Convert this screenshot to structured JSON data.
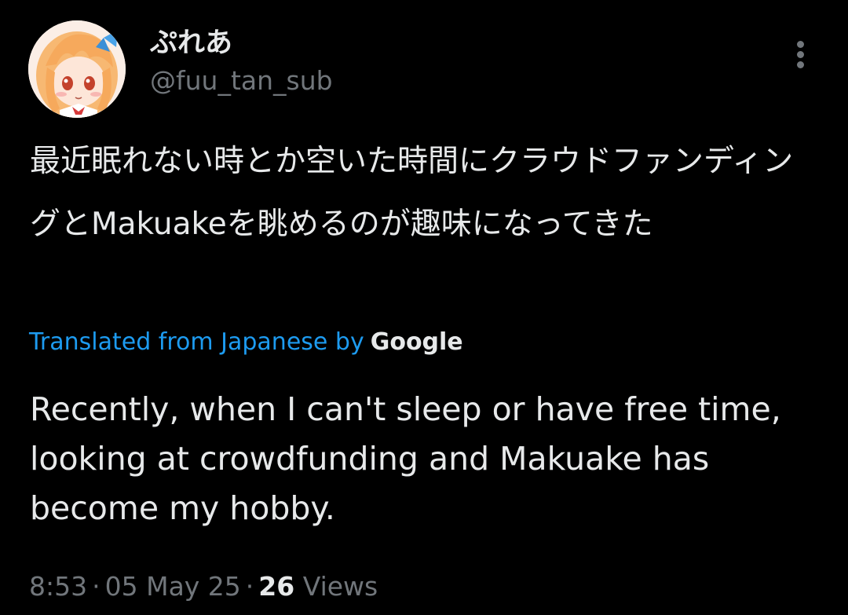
{
  "tweet": {
    "author": {
      "display_name": "ぷれあ",
      "handle": "@fuu_tan_sub",
      "avatar_icon": "anime-girl-avatar"
    },
    "more_icon": "more-vertical-icon",
    "original_text": "最近眠れない時とか空いた時間にクラウドファンディングとMakuakeを眺めるのが趣味になってきた",
    "translation": {
      "label": "Translated from Japanese by",
      "provider": "Google",
      "text": "Recently, when I can't sleep or have free time, looking at crowdfunding and Makuake has become my hobby."
    },
    "meta": {
      "time": "8:53",
      "date": "05 May 25",
      "separator": "·",
      "views_count": "26",
      "views_label": "Views"
    }
  },
  "colors": {
    "background": "#000000",
    "primary_text": "#e7e9ea",
    "secondary_text": "#71767b",
    "link": "#1d9bf0"
  }
}
